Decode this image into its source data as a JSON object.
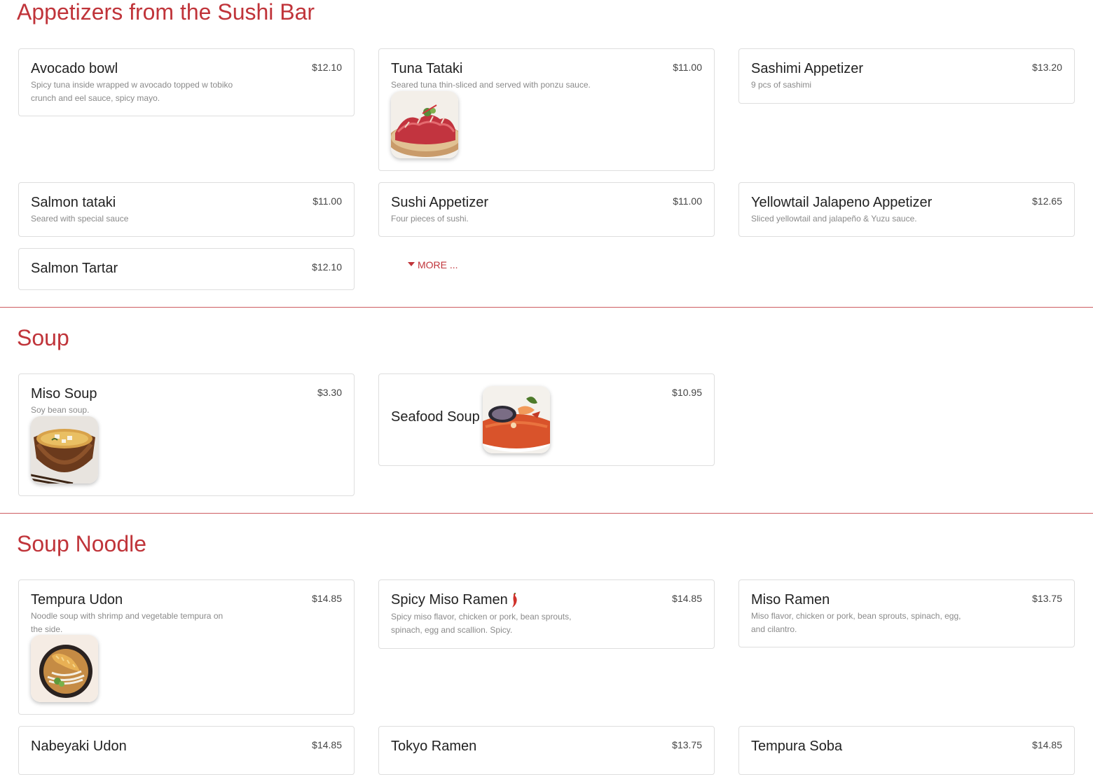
{
  "sections": [
    {
      "title": "Appetizers from the Sushi Bar",
      "items": [
        {
          "name": "Avocado bowl",
          "price": "$12.10",
          "desc": "Spicy tuna inside wrapped w avocado topped w tobiko crunch and eel sauce, spicy mayo."
        },
        {
          "name": "Tuna Tataki",
          "price": "$11.00",
          "desc": "Seared tuna thin-sliced and served with ponzu sauce.",
          "image": "tuna-tataki-photo"
        },
        {
          "name": "Sashimi Appetizer",
          "price": "$13.20",
          "desc": "9 pcs of sashimi"
        },
        {
          "name": "Salmon tataki",
          "price": "$11.00",
          "desc": "Seared with special sauce"
        },
        {
          "name": "Sushi Appetizer",
          "price": "$11.00",
          "desc": "Four pieces of sushi."
        },
        {
          "name": "Yellowtail Jalapeno Appetizer",
          "price": "$12.65",
          "desc": "Sliced yellowtail and jalapeño & Yuzu sauce."
        },
        {
          "name": "Salmon Tartar",
          "price": "$12.10"
        }
      ],
      "more_label": "MORE ..."
    },
    {
      "title": "Soup",
      "items": [
        {
          "name": "Miso Soup",
          "price": "$3.30",
          "desc": "Soy bean soup.",
          "image": "miso-soup-photo"
        },
        {
          "name": "Seafood Soup",
          "price": "$10.95",
          "image": "seafood-soup-photo"
        }
      ]
    },
    {
      "title": "Soup Noodle",
      "items": [
        {
          "name": "Tempura Udon",
          "price": "$14.85",
          "desc": "Noodle soup with shrimp and vegetable tempura on the side.",
          "image": "tempura-udon-photo"
        },
        {
          "name": "Spicy Miso Ramen",
          "price": "$14.85",
          "desc": "Spicy miso flavor, chicken or pork, bean sprouts, spinach, egg and scallion. Spicy.",
          "icon": "chili-pepper-icon"
        },
        {
          "name": "Miso Ramen",
          "price": "$13.75",
          "desc": "Miso flavor, chicken or pork, bean sprouts, spinach, egg, and cilantro."
        },
        {
          "name": "Nabeyaki Udon",
          "price": "$14.85"
        },
        {
          "name": "Tokyo Ramen",
          "price": "$13.75"
        },
        {
          "name": "Tempura Soba",
          "price": "$14.85"
        }
      ]
    }
  ],
  "colors": {
    "accent": "#c0343a",
    "border": "#dedede",
    "muted": "#8a8a8a"
  }
}
